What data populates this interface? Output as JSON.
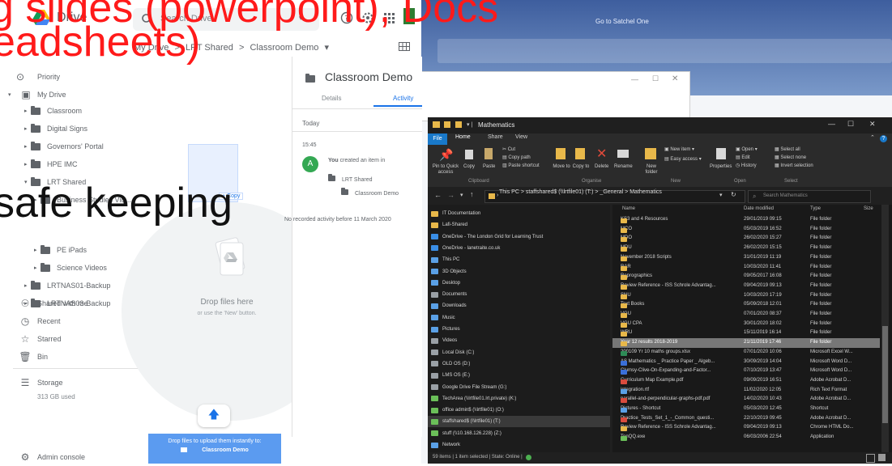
{
  "drive": {
    "app_name": "Drive",
    "search_placeholder": "Search Drive",
    "breadcrumb": [
      "My Drive",
      ">",
      "LRT Shared",
      ">",
      "Classroom Demo",
      "▾"
    ],
    "nav_items": [
      {
        "label": "Priority",
        "icon": "check-circle-icon"
      },
      {
        "label": "My Drive",
        "icon": "drive-icon"
      },
      {
        "label": "Classroom"
      },
      {
        "label": "Digital Signs"
      },
      {
        "label": "Governors' Portal"
      },
      {
        "label": "HPE IMC"
      },
      {
        "label": "LRT Shared"
      },
      {
        "label": "Business Studies Vid..."
      },
      {
        "label": "PE iPads"
      },
      {
        "label": "Science Videos"
      },
      {
        "label": "LRTNAS01-Backup"
      },
      {
        "label": "LRTNAS03-Backup"
      }
    ],
    "secondary_nav": [
      {
        "label": "Shared with me",
        "icon": "people-icon"
      },
      {
        "label": "Recent",
        "icon": "clock-icon"
      },
      {
        "label": "Starred",
        "icon": "star-icon"
      },
      {
        "label": "Bin",
        "icon": "bin-icon"
      }
    ],
    "storage_label": "Storage",
    "storage_used": "313 GB used",
    "admin_console": "Admin console",
    "drop_title": "Drop files here",
    "drop_subtitle": "or use the 'New' button.",
    "copy_tag": "+ Copy",
    "upload_banner_line1": "Drop files to upload them instantly to:",
    "upload_banner_line2": "Classroom Demo"
  },
  "details_panel": {
    "title": "Classroom Demo",
    "tab_details": "Details",
    "tab_activity": "Activity",
    "today": "Today",
    "time": "15:45",
    "avatar_letter": "A",
    "activity_you": "You",
    "activity_text": "created an item in",
    "folder_1": "LRT Shared",
    "folder_2": "Classroom Demo",
    "no_activity": "No recorded activity before 11 March 2020"
  },
  "satchel": {
    "link": "Go to Satchel One"
  },
  "explorer": {
    "title": "Mathematics",
    "tabs": [
      "File",
      "Home",
      "Share",
      "View"
    ],
    "ribbon": {
      "pin": "Pin to Quick access",
      "copy": "Copy",
      "paste": "Paste",
      "cut": "Cut",
      "copy_path": "Copy path",
      "paste_shortcut": "Paste shortcut",
      "move_to": "Move to",
      "copy_to": "Copy to",
      "delete": "Delete",
      "rename": "Rename",
      "new_folder": "New folder",
      "new_item": "New item",
      "easy_access": "Easy access",
      "properties": "Properties",
      "open": "Open",
      "edit": "Edit",
      "history": "History",
      "select_all": "Select all",
      "select_none": "Select none",
      "invert_selection": "Invert selection",
      "group_clipboard": "Clipboard",
      "group_organise": "Organise",
      "group_new": "New",
      "group_open": "Open",
      "group_select": "Select"
    },
    "address": [
      "This PC",
      ">",
      "staffshared$ (\\\\lrtfile01) (T:)",
      ">",
      "_General",
      ">",
      "Mathematics"
    ],
    "search_placeholder": "Search Mathematics",
    "nav_items": [
      {
        "label": "IT Documentation",
        "color": "#e8b84a"
      },
      {
        "label": "Lafi-Shared",
        "color": "#e8b84a"
      },
      {
        "label": "OneDrive - The London Grid for Learning Trust",
        "color": "#3a8ee6"
      },
      {
        "label": "OneDrive - lanetraite.co.uk",
        "color": "#3a8ee6"
      },
      {
        "label": "This PC",
        "color": "#5aa0e6"
      },
      {
        "label": "3D Objects",
        "color": "#5aa0e6"
      },
      {
        "label": "Desktop",
        "color": "#5aa0e6"
      },
      {
        "label": "Documents",
        "color": "#9aa0a6"
      },
      {
        "label": "Downloads",
        "color": "#5aa0e6"
      },
      {
        "label": "Music",
        "color": "#5aa0e6"
      },
      {
        "label": "Pictures",
        "color": "#5aa0e6"
      },
      {
        "label": "Videos",
        "color": "#9aa0a6"
      },
      {
        "label": "Local Disk (C:)",
        "color": "#9aa0a6"
      },
      {
        "label": "OLD OS (D:)",
        "color": "#9aa0a6"
      },
      {
        "label": "LMS OS (E:)",
        "color": "#9aa0a6"
      },
      {
        "label": "Google Drive File Stream (G:)",
        "color": "#9aa0a6"
      },
      {
        "label": "TechArea (\\\\lrtfile01.lrt.private) (K:)",
        "color": "#6bbf59"
      },
      {
        "label": "office admin$ (\\\\lrtfile01) (O:)",
        "color": "#6bbf59"
      },
      {
        "label": "staffshared$ (\\\\lrtfile01) (T:)",
        "color": "#6bbf59",
        "selected": true
      },
      {
        "label": "stuff (\\\\10.168.126.228) (Z:)",
        "color": "#6bbf59"
      },
      {
        "label": "Network",
        "color": "#5aa0e6"
      }
    ],
    "columns": [
      "Name",
      "Date modified",
      "Type",
      "Size"
    ],
    "files": [
      {
        "name": "KS3 and 4 Resources",
        "date": "29/01/2019 09:15",
        "type": "File folder",
        "color": "#e8b84a"
      },
      {
        "name": "MCO",
        "date": "05/03/2019 16:52",
        "type": "File folder",
        "color": "#e8b84a"
      },
      {
        "name": "MDO",
        "date": "26/02/2020 15:27",
        "type": "File folder",
        "color": "#e8b84a"
      },
      {
        "name": "MDU",
        "date": "26/02/2020 15:15",
        "type": "File folder",
        "color": "#e8b84a"
      },
      {
        "name": "November 2018 Scripts",
        "date": "31/01/2019 11:19",
        "type": "File folder",
        "color": "#e8b84a"
      },
      {
        "name": "RAR",
        "date": "10/03/2020 11:41",
        "type": "File folder",
        "color": "#e8b84a"
      },
      {
        "name": "Reprographics",
        "date": "09/05/2017 16:08",
        "type": "File folder",
        "color": "#e8b84a"
      },
      {
        "name": "Review Reference - ISS Schrole Advantag...",
        "date": "09/04/2019 09:13",
        "type": "File folder",
        "color": "#e8b84a"
      },
      {
        "name": "SNU",
        "date": "10/03/2020 17:19",
        "type": "File folder",
        "color": "#e8b84a"
      },
      {
        "name": "Text Books",
        "date": "05/09/2018 12:01",
        "type": "File folder",
        "color": "#e8b84a"
      },
      {
        "name": "VGU",
        "date": "07/01/2020 08:37",
        "type": "File folder",
        "color": "#e8b84a"
      },
      {
        "name": "VGU CPA",
        "date": "30/01/2020 18:02",
        "type": "File folder",
        "color": "#e8b84a"
      },
      {
        "name": "WRU",
        "date": "15/11/2019 16:14",
        "type": "File folder",
        "color": "#e8b84a"
      },
      {
        "name": "Year 12 results 2018-2019",
        "date": "21/11/2019 17:46",
        "type": "File folder",
        "color": "#e8b84a",
        "selected": true
      },
      {
        "name": "200109 Yr 10 maths groups.xlsx",
        "date": "07/01/2020 10:06",
        "type": "Microsoft Excel W...",
        "color": "#2e8b57"
      },
      {
        "name": "AS Mathematics _ Practice Paper _ Algeb...",
        "date": "30/09/2019 14:04",
        "type": "Microsoft Word D...",
        "color": "#3a6fd8"
      },
      {
        "name": "Clumsy-Clive-On-Expanding-and-Factor...",
        "date": "07/10/2019 13:47",
        "type": "Microsoft Word D...",
        "color": "#3a6fd8"
      },
      {
        "name": "Curriculum Map Example.pdf",
        "date": "09/09/2019 16:51",
        "type": "Adobe Acrobat D...",
        "color": "#d94b3d"
      },
      {
        "name": "integration.rtf",
        "date": "11/02/2020 12:05",
        "type": "Rich Text Format",
        "color": "#5aa0e6"
      },
      {
        "name": "parallel-and-perpendicular-graphs-pdf.pdf",
        "date": "14/02/2020 10:43",
        "type": "Adobe Acrobat D...",
        "color": "#d94b3d"
      },
      {
        "name": "Pictures - Shortcut",
        "date": "05/03/2020 12:45",
        "type": "Shortcut",
        "color": "#5aa0e6"
      },
      {
        "name": "Practice_Tests_Set_1_-_Common_questi...",
        "date": "22/10/2019 09:45",
        "type": "Adobe Acrobat D...",
        "color": "#d94b3d"
      },
      {
        "name": "Review Reference - ISS Schrole Advantag...",
        "date": "09/04/2019 09:13",
        "type": "Chrome HTML Do...",
        "color": "#e8b84a"
      },
      {
        "name": "TenQQ.exe",
        "date": "06/03/2006 22:54",
        "type": "Application",
        "color": "#6bbf59"
      }
    ],
    "status": "59 items  |  1 item selected  |  State: Online  |"
  },
  "overlay": {
    "line1_red": "g slides (powerpoint), Docs",
    "line2_red": "eadsheets)",
    "line3_black": "safe keeping"
  }
}
